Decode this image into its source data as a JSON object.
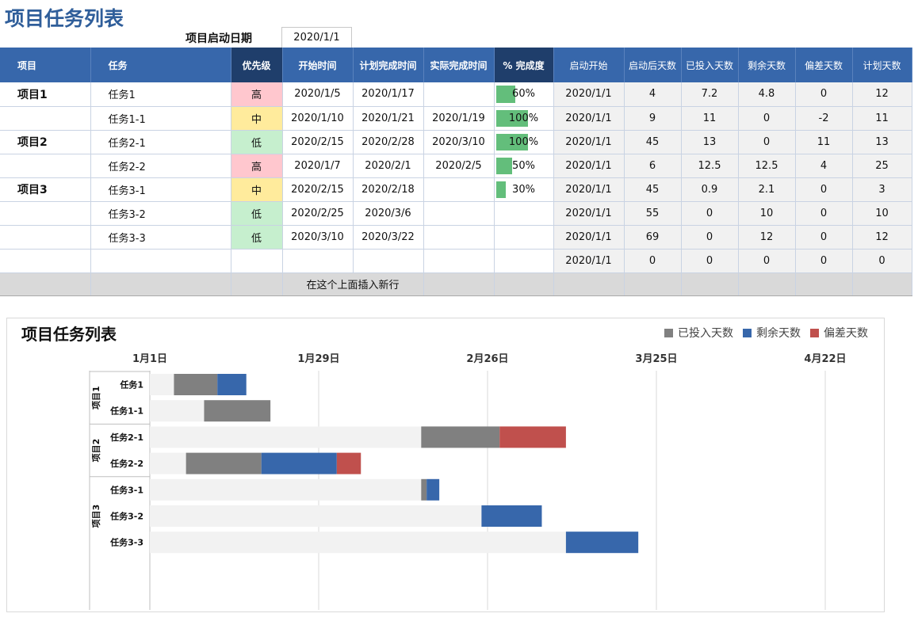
{
  "title": "项目任务列表",
  "start_date_label": "项目启动日期",
  "start_date_value": "2020/1/1",
  "headers": [
    "项目",
    "任务",
    "优先级",
    "开始时间",
    "计划完成时间",
    "实际完成时间",
    "% 完成度",
    "启动开始",
    "启动后天数",
    "已投入天数",
    "剩余天数",
    "偏差天数",
    "计划天数"
  ],
  "rows": [
    {
      "project": "项目1",
      "task": "任务1",
      "priority": "高",
      "prio_class": "high",
      "start": "2020/1/5",
      "plan_end": "2020/1/17",
      "actual_end": "",
      "pct": "60%",
      "pct_value": 0.6,
      "launch": "2020/1/1",
      "days_after": "4",
      "invested": "7.2",
      "remaining": "4.8",
      "deviation": "0",
      "planned": "12"
    },
    {
      "project": "",
      "task": "任务1-1",
      "priority": "中",
      "prio_class": "mid",
      "start": "2020/1/10",
      "plan_end": "2020/1/21",
      "actual_end": "2020/1/19",
      "pct": "100%",
      "pct_value": 1.0,
      "launch": "2020/1/1",
      "days_after": "9",
      "invested": "11",
      "remaining": "0",
      "deviation": "-2",
      "planned": "11"
    },
    {
      "project": "项目2",
      "task": "任务2-1",
      "priority": "低",
      "prio_class": "low",
      "start": "2020/2/15",
      "plan_end": "2020/2/28",
      "actual_end": "2020/3/10",
      "pct": "100%",
      "pct_value": 1.0,
      "launch": "2020/1/1",
      "days_after": "45",
      "invested": "13",
      "remaining": "0",
      "deviation": "11",
      "planned": "13"
    },
    {
      "project": "",
      "task": "任务2-2",
      "priority": "高",
      "prio_class": "high",
      "start": "2020/1/7",
      "plan_end": "2020/2/1",
      "actual_end": "2020/2/5",
      "pct": "50%",
      "pct_value": 0.5,
      "launch": "2020/1/1",
      "days_after": "6",
      "invested": "12.5",
      "remaining": "12.5",
      "deviation": "4",
      "planned": "25"
    },
    {
      "project": "项目3",
      "task": "任务3-1",
      "priority": "中",
      "prio_class": "mid",
      "start": "2020/2/15",
      "plan_end": "2020/2/18",
      "actual_end": "",
      "pct": "30%",
      "pct_value": 0.3,
      "launch": "2020/1/1",
      "days_after": "45",
      "invested": "0.9",
      "remaining": "2.1",
      "deviation": "0",
      "planned": "3"
    },
    {
      "project": "",
      "task": "任务3-2",
      "priority": "低",
      "prio_class": "low",
      "start": "2020/2/25",
      "plan_end": "2020/3/6",
      "actual_end": "",
      "pct": "",
      "pct_value": 0,
      "launch": "2020/1/1",
      "days_after": "55",
      "invested": "0",
      "remaining": "10",
      "deviation": "0",
      "planned": "10"
    },
    {
      "project": "",
      "task": "任务3-3",
      "priority": "低",
      "prio_class": "low",
      "start": "2020/3/10",
      "plan_end": "2020/3/22",
      "actual_end": "",
      "pct": "",
      "pct_value": 0,
      "launch": "2020/1/1",
      "days_after": "69",
      "invested": "0",
      "remaining": "12",
      "deviation": "0",
      "planned": "12"
    },
    {
      "project": "",
      "task": "",
      "priority": "",
      "prio_class": "",
      "start": "",
      "plan_end": "",
      "actual_end": "",
      "pct": "",
      "pct_value": 0,
      "launch": "2020/1/1",
      "days_after": "0",
      "invested": "0",
      "remaining": "0",
      "deviation": "0",
      "planned": "0"
    }
  ],
  "insert_row_text": "在这个上面插入新行",
  "colors": {
    "header_blue": "#3767ab",
    "header_dark": "#1f3e6b",
    "invested": "#808080",
    "remaining": "#3767ab",
    "deviation": "#c0504d",
    "offset": "#f2f2f2",
    "pct_bar": "#63be7b"
  },
  "chart_data": {
    "type": "bar",
    "orientation": "horizontal-stacked",
    "title": "项目任务列表",
    "legend_position": "top-right",
    "x_ticks": [
      "1月1日",
      "1月29日",
      "2月26日",
      "3月25日",
      "4月22日"
    ],
    "xlim_days": [
      0,
      112
    ],
    "groups": [
      {
        "name": "项目1",
        "tasks": [
          "任务1",
          "任务1-1"
        ]
      },
      {
        "name": "项目2",
        "tasks": [
          "任务2-1",
          "任务2-2"
        ]
      },
      {
        "name": "项目3",
        "tasks": [
          "任务3-1",
          "任务3-2",
          "任务3-3"
        ]
      }
    ],
    "categories": [
      "任务1",
      "任务1-1",
      "任务2-1",
      "任务2-2",
      "任务3-1",
      "任务3-2",
      "任务3-3"
    ],
    "offset_days": [
      4,
      9,
      45,
      6,
      45,
      55,
      69
    ],
    "series": [
      {
        "name": "已投入天数",
        "color": "#808080",
        "values": [
          7.2,
          11,
          13,
          12.5,
          0.9,
          0,
          0
        ]
      },
      {
        "name": "剩余天数",
        "color": "#3767ab",
        "values": [
          4.8,
          0,
          0,
          12.5,
          2.1,
          10,
          12
        ]
      },
      {
        "name": "偏差天数",
        "color": "#c0504d",
        "values": [
          0,
          0,
          11,
          4,
          0,
          0,
          0
        ]
      }
    ]
  }
}
